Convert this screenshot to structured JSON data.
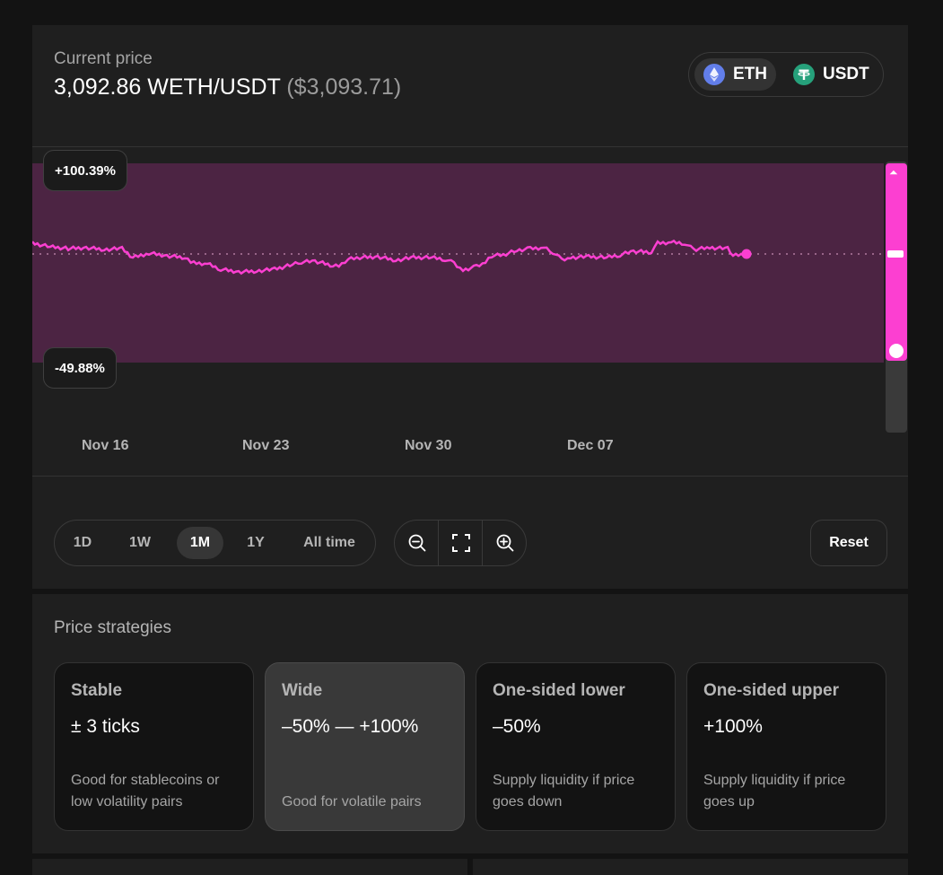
{
  "price": {
    "label": "Current price",
    "value": "3,092.86 WETH/USDT",
    "usd": "($3,093.71)"
  },
  "tokens": [
    {
      "symbol": "ETH",
      "icon": "eth-icon",
      "active": true
    },
    {
      "symbol": "USDT",
      "icon": "usdt-icon",
      "active": false
    }
  ],
  "chart": {
    "upper_label": "+100.39%",
    "lower_label": "-49.88%",
    "x_ticks": [
      "Nov 16",
      "Nov 23",
      "Nov 30",
      "Dec 07"
    ],
    "line_color": "#fc3fd1",
    "range_fill_color": "#4c2443",
    "upper_pct": 100.39,
    "lower_pct": -49.88,
    "current_price": 3092.86
  },
  "timeframes": [
    {
      "label": "1D",
      "active": false
    },
    {
      "label": "1W",
      "active": false
    },
    {
      "label": "1M",
      "active": true
    },
    {
      "label": "1Y",
      "active": false
    },
    {
      "label": "All time",
      "active": false
    }
  ],
  "zoom": [
    "zoom-out-icon",
    "fit-screen-icon",
    "zoom-in-icon"
  ],
  "reset_label": "Reset",
  "strategies": {
    "title": "Price strategies",
    "cards": [
      {
        "title": "Stable",
        "range": "± 3 ticks",
        "desc": "Good for stablecoins or low volatility pairs",
        "active": false
      },
      {
        "title": "Wide",
        "range": "–50% — +100%",
        "desc": "Good for volatile pairs",
        "active": true
      },
      {
        "title": "One-sided lower",
        "range": "–50%",
        "desc": "Supply liquidity if price goes down",
        "active": false
      },
      {
        "title": "One-sided upper",
        "range": "+100%",
        "desc": "Supply liquidity if price goes up",
        "active": false
      }
    ]
  }
}
